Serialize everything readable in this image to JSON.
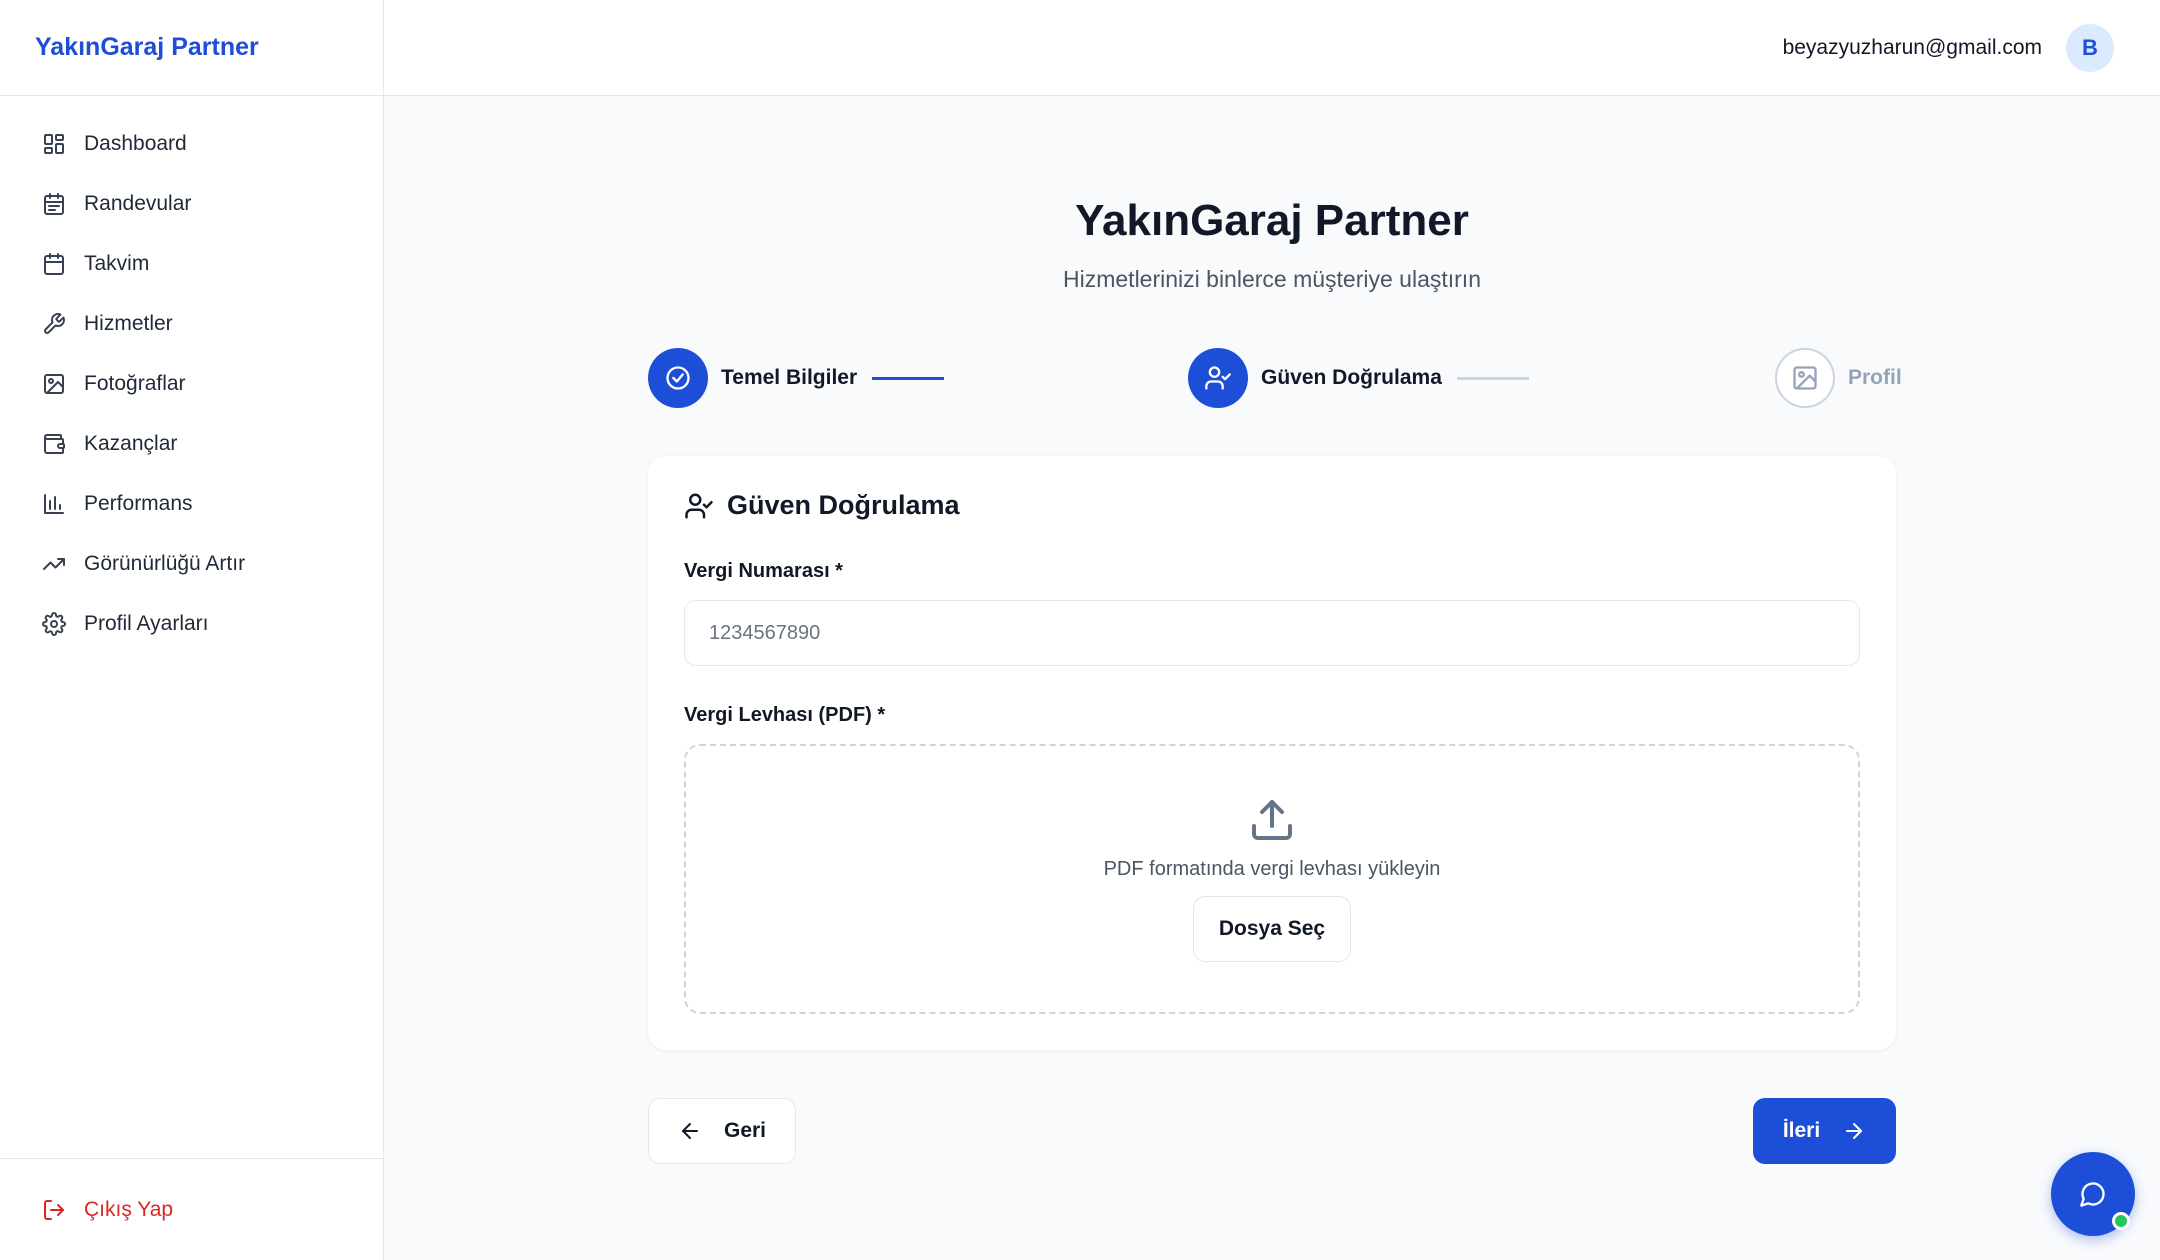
{
  "sidebar": {
    "brand": "YakınGaraj Partner",
    "items": [
      {
        "label": "Dashboard",
        "icon": "dashboard-icon"
      },
      {
        "label": "Randevular",
        "icon": "calendar-list-icon"
      },
      {
        "label": "Takvim",
        "icon": "calendar-icon"
      },
      {
        "label": "Hizmetler",
        "icon": "wrench-icon"
      },
      {
        "label": "Fotoğraflar",
        "icon": "image-icon"
      },
      {
        "label": "Kazançlar",
        "icon": "wallet-icon"
      },
      {
        "label": "Performans",
        "icon": "bar-chart-icon"
      },
      {
        "label": "Görünürlüğü Artır",
        "icon": "trending-up-icon"
      },
      {
        "label": "Profil Ayarları",
        "icon": "gear-icon"
      }
    ],
    "logout_label": "Çıkış Yap"
  },
  "topbar": {
    "email": "beyazyuzharun@gmail.com",
    "avatar_initial": "B"
  },
  "page": {
    "title": "YakınGaraj Partner",
    "subtitle": "Hizmetlerinizi binlerce müşteriye ulaştırın"
  },
  "stepper": {
    "steps": [
      {
        "label": "Temel Bilgiler",
        "state": "completed",
        "icon": "check-circle-icon"
      },
      {
        "label": "Güven Doğrulama",
        "state": "active",
        "icon": "user-check-icon"
      },
      {
        "label": "Profil",
        "state": "pending",
        "icon": "image-icon"
      }
    ]
  },
  "card": {
    "title": "Güven Doğrulama",
    "tax_number": {
      "label": "Vergi Numarası *",
      "placeholder": "1234567890",
      "value": ""
    },
    "tax_certificate": {
      "label": "Vergi Levhası (PDF) *",
      "hint": "PDF formatında vergi levhası yükleyin",
      "button_label": "Dosya Seç"
    }
  },
  "actions": {
    "back_label": "Geri",
    "next_label": "İleri"
  },
  "colors": {
    "primary": "#1d4ed8",
    "danger": "#dc2626",
    "online": "#22c55e",
    "pending": "#94a3b8"
  }
}
